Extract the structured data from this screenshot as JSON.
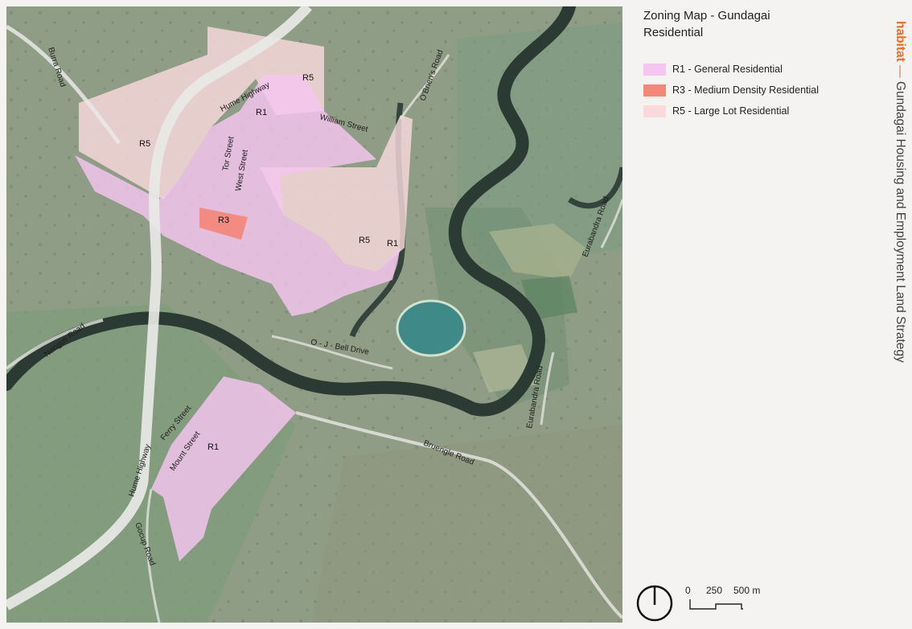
{
  "title": "Zoning Map - Gundagai Residential",
  "legend": [
    {
      "code": "R1",
      "label": "R1 - General Residential",
      "color": "#f5c6f0"
    },
    {
      "code": "R3",
      "label": "R3 - Medium Density Residential",
      "color": "#f4877a"
    },
    {
      "code": "R5",
      "label": "R5 - Large Lot Residential",
      "color": "#f9d9dc"
    }
  ],
  "map": {
    "zone_labels": [
      "R5",
      "R1",
      "R5",
      "R3",
      "R5",
      "R1",
      "R1"
    ],
    "road_labels": [
      "Hume Highway",
      "Hume Highway",
      "William Street",
      "Tor Street",
      "West Street",
      "O'Brien's Road",
      "Eurabandra Road",
      "O - J - Bell Drive",
      "Nangus Road",
      "Burra Road",
      "Ferry Street",
      "Mount Street",
      "Bruengle Road",
      "Gocup Road",
      "Eurabandra Road"
    ]
  },
  "scale": {
    "labels": [
      "0",
      "250",
      "500 m"
    ]
  },
  "side_title": {
    "brand": "habitat",
    "separator": "—",
    "text": "Gundagai Housing and Employment Land Strategy"
  },
  "colors": {
    "accent": "#f06a24",
    "background": "#f4f3f1",
    "river": "#2c3a34",
    "road": "#e9e9e6"
  }
}
